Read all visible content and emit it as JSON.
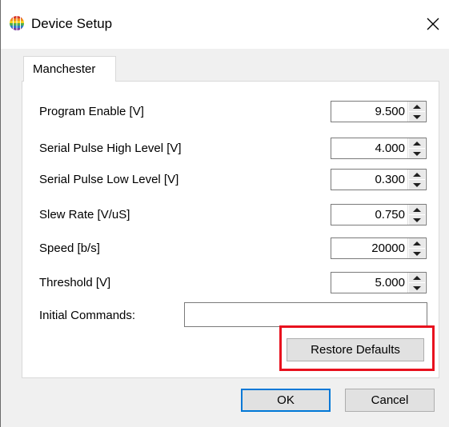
{
  "window": {
    "title": "Device Setup",
    "icon": "rainbow-globe-icon",
    "close_icon": "close-icon"
  },
  "tabs": [
    {
      "label": "Manchester",
      "selected": true
    }
  ],
  "fields": [
    {
      "label": "Program Enable [V]",
      "value": "9.500"
    },
    {
      "label": "Serial Pulse High Level [V]",
      "value": "4.000"
    },
    {
      "label": "Serial Pulse Low Level [V]",
      "value": "0.300"
    },
    {
      "label": "Slew Rate [V/uS]",
      "value": "0.750"
    },
    {
      "label": "Speed [b/s]",
      "value": "20000"
    },
    {
      "label": "Threshold [V]",
      "value": "5.000"
    }
  ],
  "initial_commands": {
    "label": "Initial Commands:",
    "value": ""
  },
  "buttons": {
    "restore_defaults": "Restore Defaults",
    "ok": "OK",
    "cancel": "Cancel"
  },
  "colors": {
    "highlight": "#e8111e",
    "default_button_border": "#0078d7"
  }
}
